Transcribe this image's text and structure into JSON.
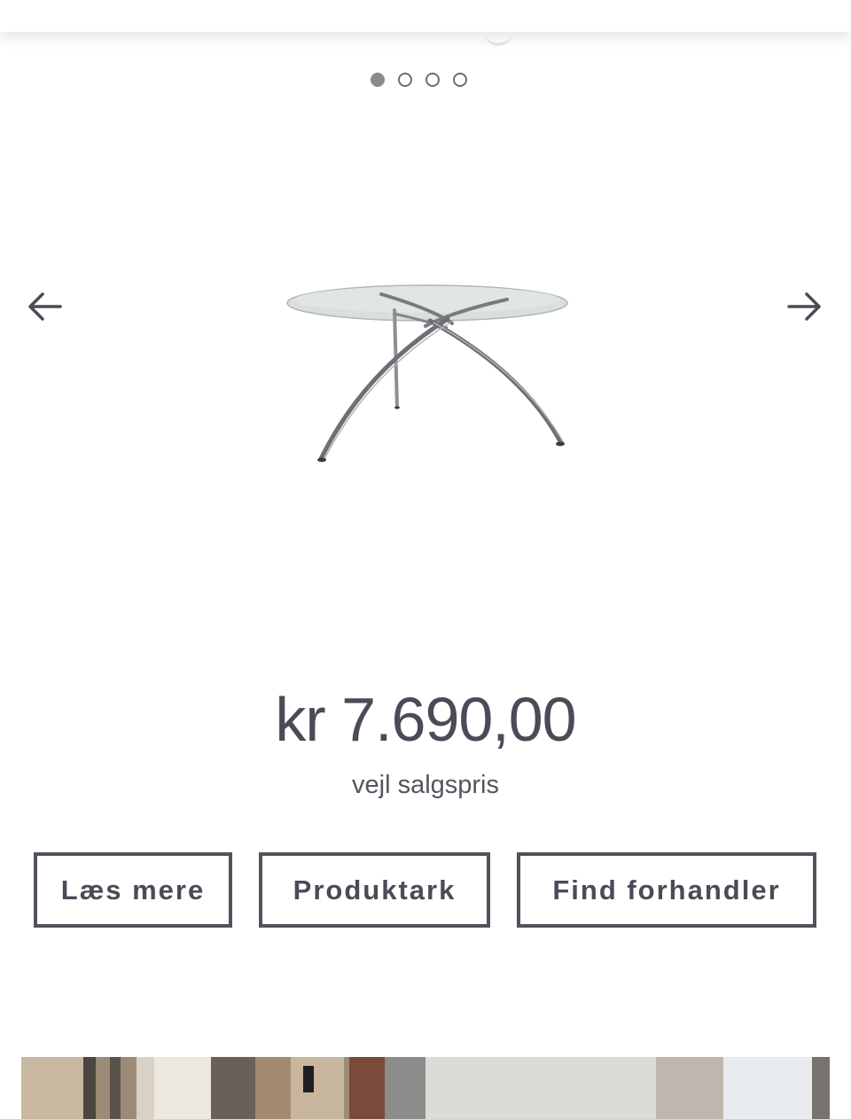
{
  "carousel": {
    "slide_count": 4,
    "active_index": 0,
    "prev_label": "←",
    "next_label": "→"
  },
  "product": {
    "image_alt": "Glass dining table with chrome legs",
    "price": "kr 7.690,00",
    "price_label": "vejl salgspris"
  },
  "actions": {
    "read_more": "Læs mere",
    "product_sheet": "Produktark",
    "find_dealer": "Find forhandler"
  },
  "colors": {
    "text": "#4b4b57",
    "button_border": "#52525c",
    "dot_active": "#8a8a92"
  },
  "icons": [
    "arrow-left-icon",
    "arrow-right-icon"
  ]
}
